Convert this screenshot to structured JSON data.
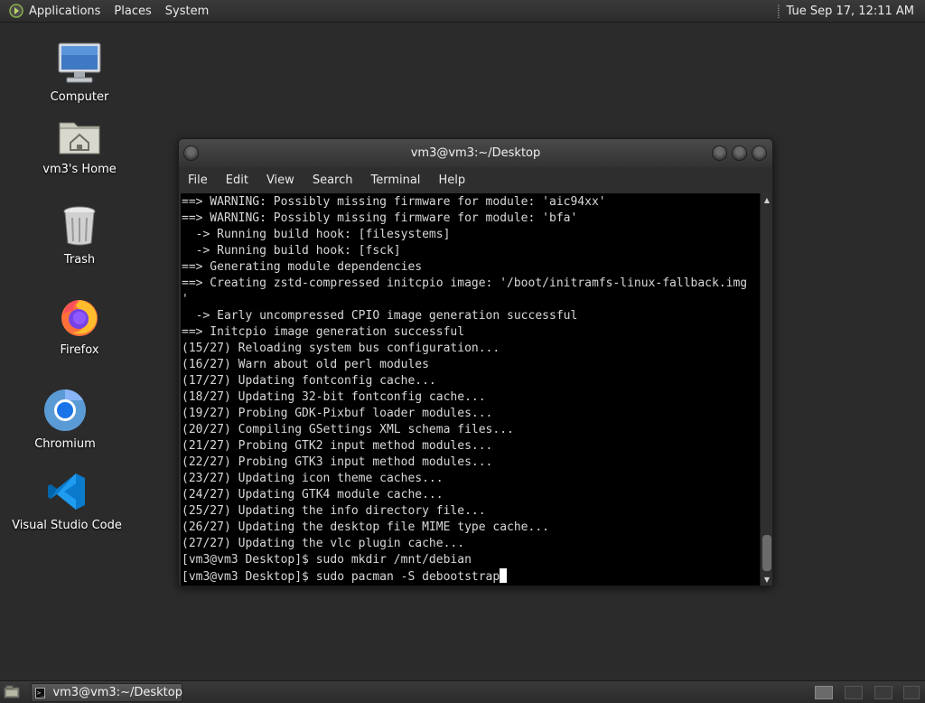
{
  "top_panel": {
    "menus": [
      "Applications",
      "Places",
      "System"
    ],
    "clock": "Tue Sep 17, 12:11 AM"
  },
  "desktop_icons": {
    "computer": "Computer",
    "home": "vm3's Home",
    "trash": "Trash",
    "firefox": "Firefox",
    "chromium": "Chromium",
    "vscode": "Visual Studio Code"
  },
  "window": {
    "title": "vm3@vm3:~/Desktop",
    "menu": [
      "File",
      "Edit",
      "View",
      "Search",
      "Terminal",
      "Help"
    ],
    "terminal_lines": [
      "==> WARNING: Possibly missing firmware for module: 'aic94xx'",
      "==> WARNING: Possibly missing firmware for module: 'bfa'",
      "  -> Running build hook: [filesystems]",
      "  -> Running build hook: [fsck]",
      "==> Generating module dependencies",
      "==> Creating zstd-compressed initcpio image: '/boot/initramfs-linux-fallback.img",
      "'",
      "  -> Early uncompressed CPIO image generation successful",
      "==> Initcpio image generation successful",
      "(15/27) Reloading system bus configuration...",
      "(16/27) Warn about old perl modules",
      "(17/27) Updating fontconfig cache...",
      "(18/27) Updating 32-bit fontconfig cache...",
      "(19/27) Probing GDK-Pixbuf loader modules...",
      "(20/27) Compiling GSettings XML schema files...",
      "(21/27) Probing GTK2 input method modules...",
      "(22/27) Probing GTK3 input method modules...",
      "(23/27) Updating icon theme caches...",
      "(24/27) Updating GTK4 module cache...",
      "(25/27) Updating the info directory file...",
      "(26/27) Updating the desktop file MIME type cache...",
      "(27/27) Updating the vlc plugin cache...",
      "[vm3@vm3 Desktop]$ sudo mkdir /mnt/debian"
    ],
    "prompt": "[vm3@vm3 Desktop]$ ",
    "current_input": "sudo pacman -S debootstrap"
  },
  "taskbar": {
    "task_label": "vm3@vm3:~/Desktop",
    "workspace_count": 4,
    "active_workspace": 1
  }
}
